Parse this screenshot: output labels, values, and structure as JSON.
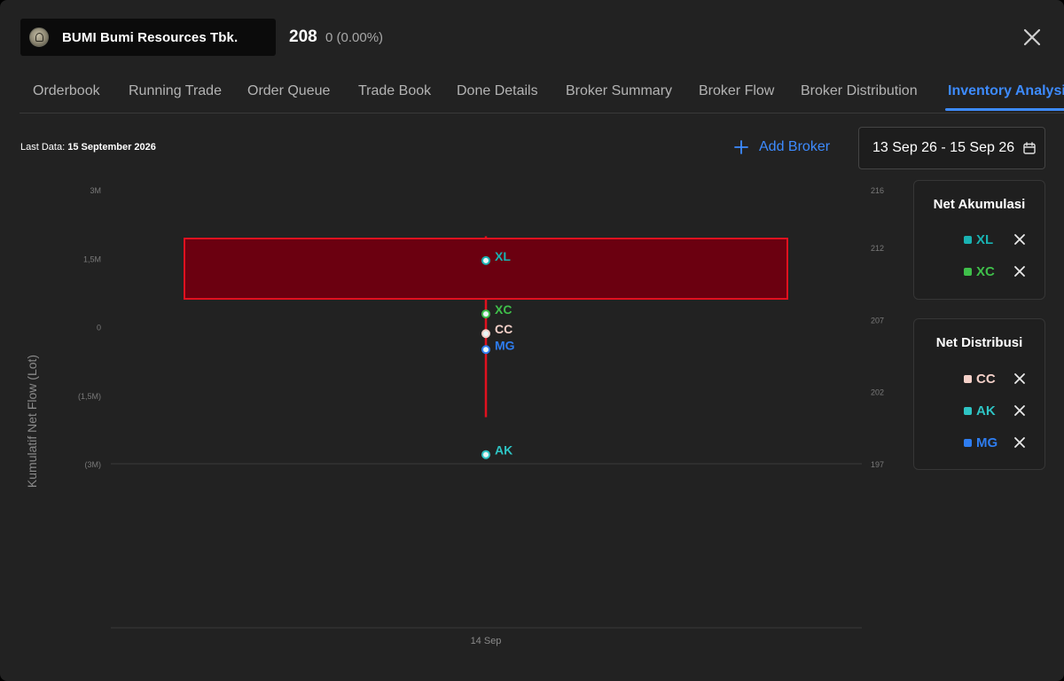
{
  "header": {
    "stock_name": "BUMI Bumi Resources Tbk.",
    "price": "208",
    "change": "0 (0.00%)",
    "logo_icon": "bumi-logo"
  },
  "tabs": [
    {
      "label": "Orderbook",
      "active": false
    },
    {
      "label": "Running Trade",
      "active": false
    },
    {
      "label": "Order Queue",
      "active": false
    },
    {
      "label": "Trade Book",
      "active": false
    },
    {
      "label": "Done Details",
      "active": false
    },
    {
      "label": "Broker Summary",
      "active": false
    },
    {
      "label": "Broker Flow",
      "active": false
    },
    {
      "label": "Broker Distribution",
      "active": false
    },
    {
      "label": "Inventory Analysis",
      "active": true
    }
  ],
  "toolbar": {
    "last_data_prefix": "Last Data: ",
    "last_data_value": "15 September 2026",
    "add_broker_label": "Add Broker",
    "date_range": "13 Sep 26 - 15 Sep 26"
  },
  "chart_data": {
    "type": "scatter",
    "ylabel": "Kumulatif Net Flow (Lot)",
    "left_ticks": [
      {
        "label": "3M",
        "value": 3000000
      },
      {
        "label": "1,5M",
        "value": 1500000
      },
      {
        "label": "0",
        "value": 0
      },
      {
        "label": "(1,5M)",
        "value": -1500000
      },
      {
        "label": "(3M)",
        "value": -3000000
      }
    ],
    "right_ticks": [
      {
        "label": "216",
        "value": 216
      },
      {
        "label": "212",
        "value": 212
      },
      {
        "label": "207",
        "value": 207
      },
      {
        "label": "202",
        "value": 202
      },
      {
        "label": "197",
        "value": 197
      }
    ],
    "x_categories": [
      "14 Sep"
    ],
    "candle": {
      "open": 208,
      "close": 211,
      "high": 214,
      "low": 199,
      "color": "#e0111f",
      "fill": "#6b0010"
    },
    "points": [
      {
        "broker": "XL",
        "value": 1450000,
        "color": "#19b2b2"
      },
      {
        "broker": "XC",
        "value": 280000,
        "color": "#3fbf4a"
      },
      {
        "broker": "CC",
        "value": -150000,
        "color": "#f4d0c8"
      },
      {
        "broker": "MG",
        "value": -500000,
        "color": "#2e7df0"
      },
      {
        "broker": "AK",
        "value": -2800000,
        "color": "#2ec4c4"
      }
    ]
  },
  "legend": {
    "accumulation_title": "Net Akumulasi",
    "accumulation": [
      {
        "code": "XL",
        "color": "#19b2b2"
      },
      {
        "code": "XC",
        "color": "#3fbf4a"
      }
    ],
    "distribution_title": "Net Distribusi",
    "distribution": [
      {
        "code": "CC",
        "color": "#f4d0c8"
      },
      {
        "code": "AK",
        "color": "#2ec4c4"
      },
      {
        "code": "MG",
        "color": "#2e7df0"
      }
    ]
  }
}
